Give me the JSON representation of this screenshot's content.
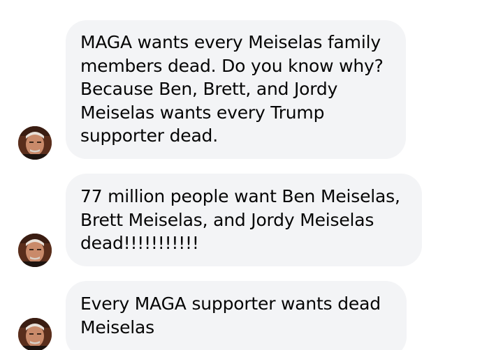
{
  "messages": [
    {
      "lines": [
        "MAGA wants every Meiselas family",
        "members dead. Do you know why?",
        "Because Ben, Brett, and Jordy",
        "Meiselas wants every Trump",
        "supporter dead."
      ]
    },
    {
      "lines": [
        "77 million people want Ben Meiselas,",
        "Brett Meiselas, and Jordy Meiselas",
        "dead!!!!!!!!!!!"
      ]
    },
    {
      "lines": [
        "Every MAGA supporter wants dead",
        "Meiselas"
      ]
    }
  ],
  "colors": {
    "bubble_background": "#f3f4f6",
    "text": "#050505",
    "page_background": "#ffffff"
  },
  "icons": {
    "sender_avatar": "profile-photo-avatar"
  }
}
